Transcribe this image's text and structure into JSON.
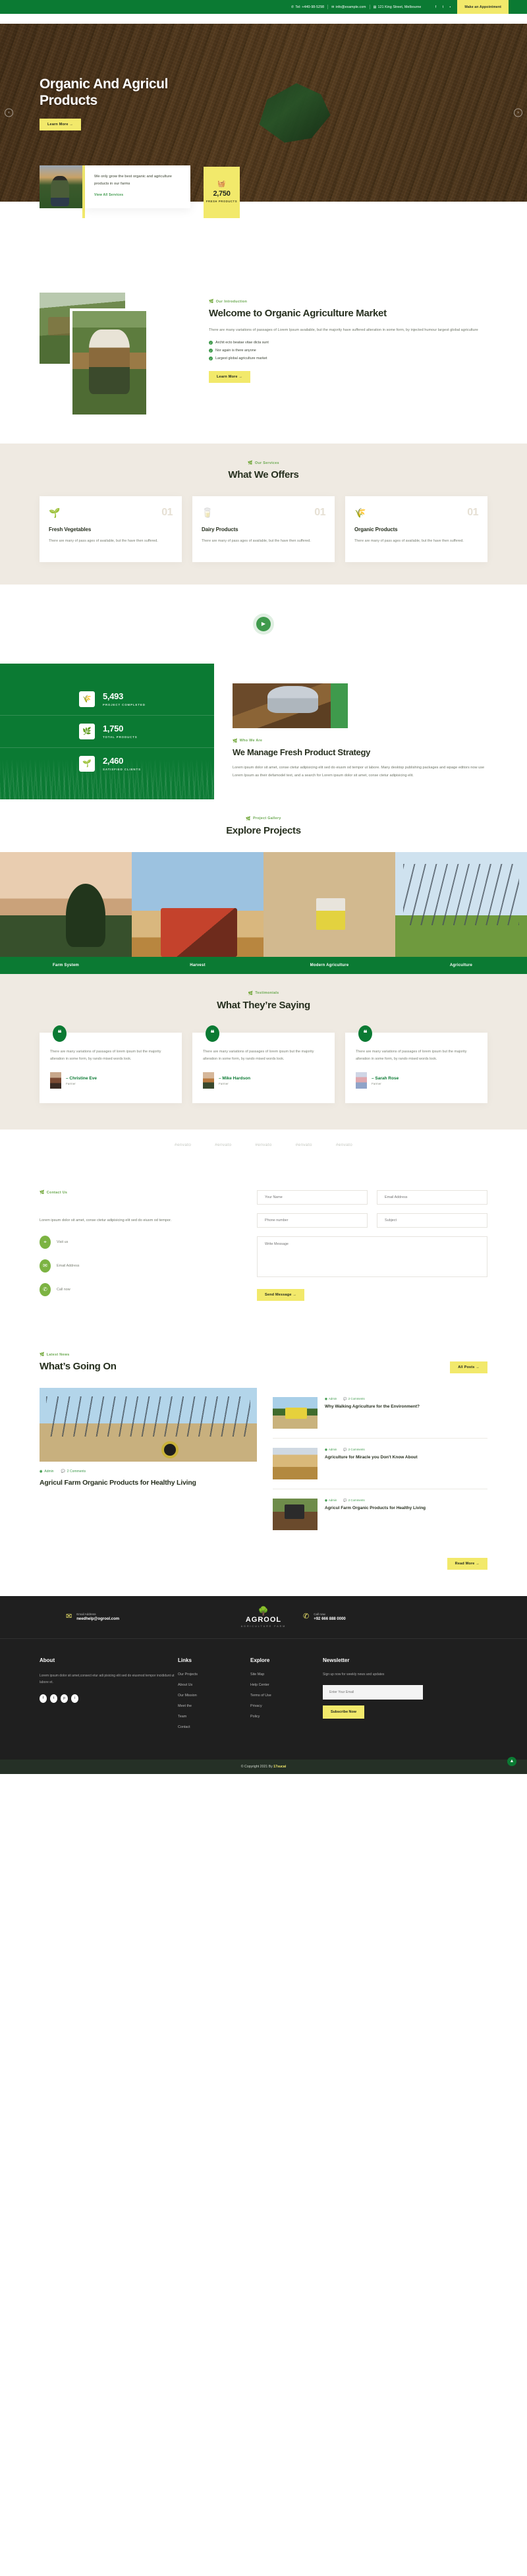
{
  "topbar": {
    "phone": "Tel: +440-98-5298",
    "email": "info@example.com",
    "address": "121 King Street, Melbourne",
    "social": [
      "facebook-icon",
      "twitter-icon",
      "youtube-icon"
    ],
    "appointment_label": "Make an Appointment"
  },
  "hero": {
    "title": "Organic And Agricul Products",
    "cta": "Learn More  →",
    "prev": "‹",
    "next": "›"
  },
  "feature_strip": {
    "text": "We only grow the best organic and agriculture products in our farms",
    "link": "View All Services",
    "stat_number": "2,750",
    "stat_label": "FRESH PRODUCTS",
    "stat_icon": "basket-icon"
  },
  "welcome": {
    "eyebrow": "Our Introduction",
    "title": "Welcome to Organic Agriculture Market",
    "paragraph": "There are many variations of passages of Lorem Ipsum available, but the majority have suffered alteration in some form, by injected humour largest global agriculture",
    "list": [
      "Archit ecto beatae vitae dicta sunt",
      "Nor again is there anyone",
      "Largest global agriculture market"
    ],
    "cta": "Learn More  →"
  },
  "offers": {
    "eyebrow": "Our Services",
    "title": "What We Offers",
    "cards": [
      {
        "icon": "sprout-icon",
        "number": "01",
        "title": "Fresh Vegetables",
        "text": "There are many of pass ages of available, but the have then suffered."
      },
      {
        "icon": "milk-bottle-icon",
        "number": "01",
        "title": "Dairy Products",
        "text": "There are many of pass ages of available, but the have then suffered."
      },
      {
        "icon": "organic-plant-icon",
        "number": "01",
        "title": "Organic Products",
        "text": "There are many of pass ages of available, but the have then suffered."
      }
    ]
  },
  "video": {
    "play_icon": "play-icon"
  },
  "stats": [
    {
      "icon": "harvest-icon",
      "number": "5,493",
      "label": "PROJECT COMPLETED"
    },
    {
      "icon": "plant-icon",
      "number": "1,750",
      "label": "TOTAL PRODUCTS"
    },
    {
      "icon": "wheat-icon",
      "number": "2,460",
      "label": "SATISFIED CLIENTS"
    }
  ],
  "strategy": {
    "eyebrow": "Who We Are",
    "title": "We Manage Fresh Product Strategy",
    "paragraph": "Lorem ipsum dolor sit amet, conse ctetur adipisicing elit sed do eiusm od tempor ut labore. Many desktop publishing packages and wpage editors now use Lorem Ipsum as their defamodel text, and a search for Lorem ipsum dolor sit amet, conse ctetur adipisicing elit."
  },
  "projects": {
    "eyebrow": "Project Gallery",
    "title": "Explore Projects",
    "items": [
      {
        "label": "Farm System"
      },
      {
        "label": "Harvest"
      },
      {
        "label": "Modern Agriculture"
      },
      {
        "label": "Agriculture"
      }
    ]
  },
  "testimonials": {
    "eyebrow": "Testimonials",
    "title": "What They’re Saying",
    "items": [
      {
        "quote": "There are many variations of passages of lorem ipsum but the majority alteration in some form, by rando mised words look.",
        "name": "– Christine Eve",
        "role": "Farmer"
      },
      {
        "quote": "There are many variations of passages of lorem ipsum but the majority alteration in some form, by rando mised words look.",
        "name": "– Mike Hardson",
        "role": "Farmer"
      },
      {
        "quote": "There are many variations of passages of lorem ipsum but the majority alteration in some form, by rando mised words look.",
        "name": "– Sarah Rose",
        "role": "Farmer"
      }
    ]
  },
  "brands": [
    "#envato",
    "#envato",
    "#envato",
    "#envato",
    "#envato"
  ],
  "contact": {
    "eyebrow": "Contact Us",
    "paragraph": "Lorem ipsum dolor sit amet, conse ctetur adipisicing elit sed do eiusm od tempor.",
    "items": [
      {
        "icon": "map-pin-icon",
        "label": "Visit us"
      },
      {
        "icon": "envelope-icon",
        "label": "Email Address"
      },
      {
        "icon": "phone-icon",
        "label": "Call now"
      }
    ],
    "form": {
      "name_placeholder": "Your Name",
      "email_placeholder": "Email Address",
      "phone_placeholder": "Phone number",
      "subject_placeholder": "Subject",
      "message_placeholder": "Write Message",
      "submit_label": "Send Message  →"
    }
  },
  "blog": {
    "eyebrow": "Latest News",
    "title": "What’s Going On",
    "all_posts_label": "All Posts  →",
    "read_more_label": "Read More  →",
    "main": {
      "author": "Admin",
      "comments": "2 Comments",
      "title": "Agricul Farm Organic Products for Healthy Living"
    },
    "side": [
      {
        "author": "Admin",
        "comments": "2 Comments",
        "title": "Why Walking Agriculture for the Environment?"
      },
      {
        "author": "Admin",
        "comments": "2 Comments",
        "title": "Agriculture for Miracle you Don't Know About"
      },
      {
        "author": "Admin",
        "comments": "2 Comments",
        "title": "Agricul Farm Organic Products for Healthy Living"
      }
    ]
  },
  "footer": {
    "email_label": "Email Address",
    "email_value": "needhelp@ogrool.com",
    "phone_label": "Call now",
    "phone_value": "+92 666 888 0000",
    "logo_name": "AGROOL",
    "logo_sub": "AGRICULTURE FARM",
    "about_heading": "About",
    "about_text": "Lorem ipsum dolor sit amet,consect etur adi pisicing elit sed do eiusmod tempor incididunt ut labore et.",
    "social": [
      "f",
      "t",
      "p",
      "i"
    ],
    "links_heading": "Links",
    "links": [
      "Our Projects",
      "About Us",
      "Our Mission",
      "Meet the",
      "Team",
      "Contact"
    ],
    "explore_heading": "Explore",
    "explore": [
      "Site Map",
      "Help Center",
      "Terms of Use",
      "Privacy",
      "Policy"
    ],
    "newsletter_heading": "Newsletter",
    "newsletter_text": "Sign up now for weekly news and updates",
    "newsletter_placeholder": "Enter Your Email",
    "subscribe_label": "Subscribe Now",
    "copyright": "© Copyright 2021 By ",
    "copyright_brand": "17sucai",
    "to_top_icon": "chevron-up-icon"
  }
}
